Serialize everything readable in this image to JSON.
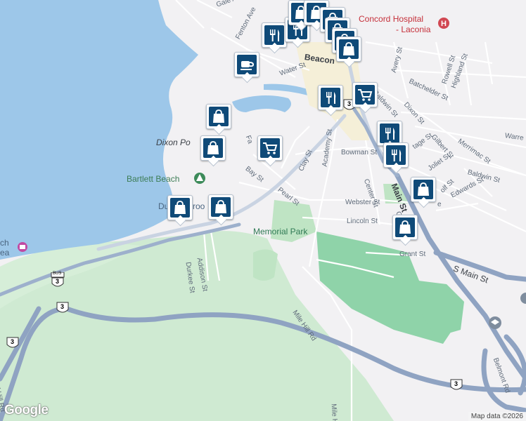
{
  "map": {
    "colors": {
      "water": "#9dc7e9",
      "land": "#f2f1f3",
      "park": "#bfe4c4",
      "park_dark": "#8fd3a9",
      "highway": "#8fa3c2",
      "road": "#ffffff",
      "pin_fill": "#0f4a78"
    },
    "labels": {
      "gale_ave": "Gale Ave",
      "fenton_ave": "Fenton Ave",
      "beacon": "Beacon",
      "water_st": "Water St",
      "dixon_pond": "Dixon Po",
      "bartlett_beach": "Bartlett Beach",
      "dunk_brook": "Du",
      "brook": "Broo",
      "bay_st": "Bay St",
      "pearl_st": "Pearl St",
      "clay_st": "Clay St",
      "academy_st": "Academy St",
      "bowman_st": "Bowman St",
      "center_st": "Center St",
      "main_st": "Main St",
      "webster_st": "Webster St",
      "lincoln_st": "Lincoln St",
      "memorial_park": "Memorial Park",
      "grant_st": "Grant St",
      "s_main_st": "S Main St",
      "addison_st": "Addison St",
      "durkee_st": "Durkee St",
      "mile_hill_rd": "Mile Hill Rd",
      "mile_hill_rd_2": "Mile Hill Rd",
      "ladd_hill_rd": "Ladd Hill Rd",
      "belmont_rd": "Belmont Rd",
      "avery_st": "Avery St",
      "batchelder_st": "Batchelder St",
      "rowell_st": "Rowell St",
      "highland_st": "Highland St",
      "baldwin_st": "Baldwin St",
      "baldwin_st_2": "Baldwin St",
      "dixon_st": "Dixon St",
      "gilbert_st": "Gilbert St",
      "merrimac_st": "Merrimac St",
      "warren": "Warre",
      "hosp_1": "Concord Hospital",
      "hosp_2": "- Laconia",
      "fa": "Fa",
      "beach_area_1": "ch",
      "beach_area_2": "ea",
      "ta": "tage St",
      "jo": "Joliet St",
      "wo": "olf St",
      "ed": "Edwards St",
      "ga": "Ga",
      "e_": "e"
    },
    "shields": {
      "bus_top": "BUS",
      "route_bus": "3",
      "route_a": "3",
      "route_b": "3",
      "route_c": "3",
      "route_d": "3"
    },
    "branding": {
      "logo": "Google",
      "attribution": "Map data ©2026"
    },
    "markers": [
      {
        "icon": "cafe-icon"
      },
      {
        "icon": "restaurant-icon"
      },
      {
        "icon": "restaurant-icon"
      },
      {
        "icon": "shopping-bag-icon"
      },
      {
        "icon": "shopping-bag-icon"
      },
      {
        "icon": "shopping-bag-icon"
      },
      {
        "icon": "shopping-bag-icon"
      },
      {
        "icon": "shopping-bag-icon"
      },
      {
        "icon": "shopping-bag-icon"
      },
      {
        "icon": "restaurant-icon"
      },
      {
        "icon": "shopping-cart-icon"
      },
      {
        "icon": "shopping-bag-icon"
      },
      {
        "icon": "shopping-bag-icon"
      },
      {
        "icon": "shopping-cart-icon"
      },
      {
        "icon": "shopping-bag-icon"
      },
      {
        "icon": "shopping-bag-icon"
      },
      {
        "icon": "restaurant-icon"
      },
      {
        "icon": "restaurant-icon"
      },
      {
        "icon": "shopping-bag-icon"
      },
      {
        "icon": "shopping-bag-icon"
      }
    ]
  }
}
